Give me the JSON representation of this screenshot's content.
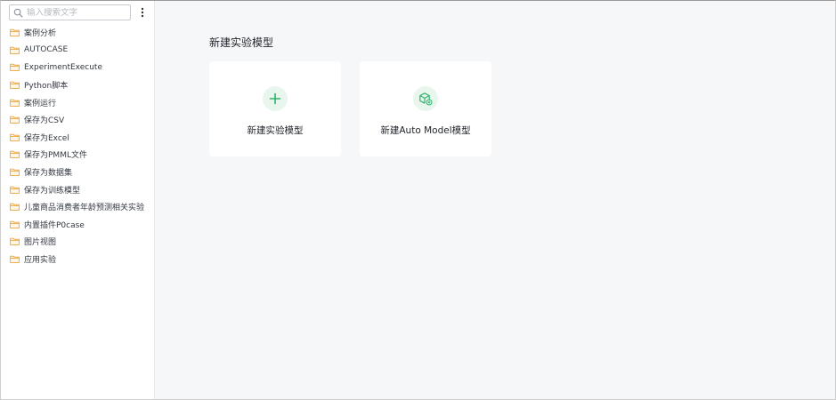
{
  "sidebar": {
    "search_placeholder": "输入搜索文字",
    "items": [
      {
        "label": "案例分析"
      },
      {
        "label": "AUTOCASE"
      },
      {
        "label": "ExperimentExecute"
      },
      {
        "label": "Python脚本"
      },
      {
        "label": "案例运行"
      },
      {
        "label": "保存为CSV"
      },
      {
        "label": "保存为Excel"
      },
      {
        "label": "保存为PMML文件"
      },
      {
        "label": "保存为数据集"
      },
      {
        "label": "保存为训练模型"
      },
      {
        "label": "儿童商品消费者年龄预测相关实验"
      },
      {
        "label": "内置插件P0case"
      },
      {
        "label": "图片视图"
      },
      {
        "label": "应用实验"
      }
    ]
  },
  "main": {
    "title": "新建实验模型",
    "cards": [
      {
        "label": "新建实验模型",
        "icon": "plus-icon"
      },
      {
        "label": "新建Auto Model模型",
        "icon": "cube-plus-icon"
      }
    ]
  },
  "colors": {
    "folder": "#f0a33a",
    "accent": "#2fb36b",
    "accent_bg": "#e8f6ee",
    "background": "#f6f7f9"
  }
}
